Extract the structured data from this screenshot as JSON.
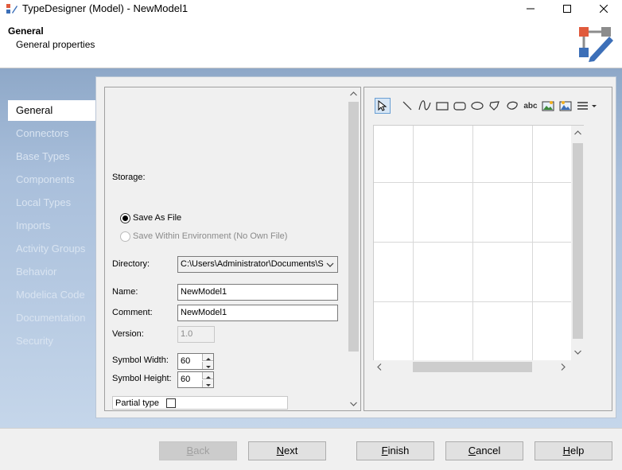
{
  "window": {
    "title": "TypeDesigner (Model) - NewModel1"
  },
  "header": {
    "title": "General",
    "subtitle": "General properties"
  },
  "nav": {
    "items": [
      {
        "label": "General"
      },
      {
        "label": "Connectors"
      },
      {
        "label": "Base Types"
      },
      {
        "label": "Components"
      },
      {
        "label": "Local Types"
      },
      {
        "label": "Imports"
      },
      {
        "label": "Activity Groups"
      },
      {
        "label": "Behavior"
      },
      {
        "label": "Modelica Code"
      },
      {
        "label": "Documentation"
      },
      {
        "label": "Security"
      }
    ]
  },
  "form": {
    "storage_label": "Storage:",
    "save_as_file": "Save As File",
    "save_within_env": "Save Within Environment (No Own File)",
    "directory_label": "Directory:",
    "directory_value": "C:\\Users\\Administrator\\Documents\\S",
    "name_label": "Name:",
    "name_value": "NewModel1",
    "comment_label": "Comment:",
    "comment_value": "NewModel1",
    "version_label": "Version:",
    "version_value": "1.0",
    "symbol_width_label": "Symbol Width:",
    "symbol_width_value": "60",
    "symbol_height_label": "Symbol Height:",
    "symbol_height_value": "60",
    "partial_type_label": "Partial type"
  },
  "toolbar": {
    "text_tool": "abc"
  },
  "footer": {
    "back_first": "B",
    "back_rest": "ack",
    "next_first": "N",
    "next_rest": "ext",
    "finish_first": "F",
    "finish_rest": "inish",
    "cancel_first": "C",
    "cancel_rest": "ancel",
    "help_first": "H",
    "help_rest": "elp"
  }
}
